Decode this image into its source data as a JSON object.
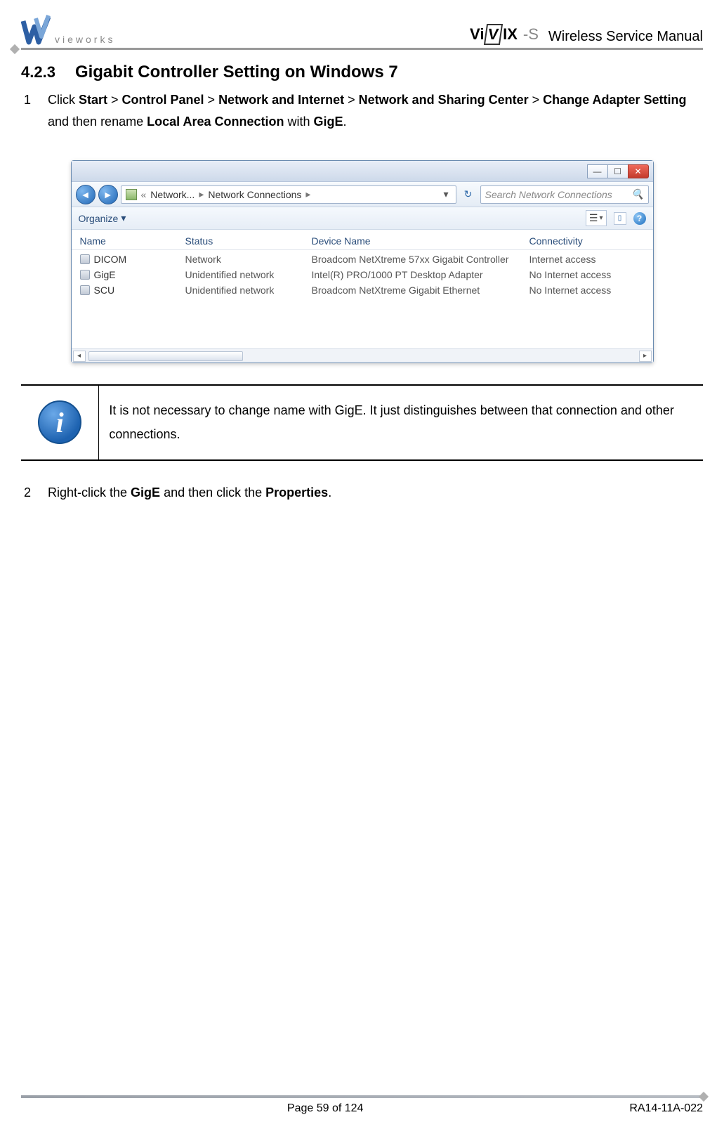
{
  "header": {
    "brand_text": "vieworks",
    "product_logo_left": "Vi",
    "product_logo_box": "V",
    "product_logo_mid": "IX",
    "product_logo_suffix": "-S",
    "doc_title": "Wireless Service Manual"
  },
  "section": {
    "number": "4.2.3",
    "title": "Gigabit Controller Setting on Windows 7"
  },
  "steps": {
    "s1_num": "1",
    "s1_parts": {
      "a": "Click ",
      "start": "Start",
      "gt1": " > ",
      "cp": "Control Panel",
      "gt2": " > ",
      "ni": "Network and Internet",
      "gt3": " > ",
      "nsc": "Network and Sharing Center",
      "gt4": " > ",
      "cas": "Change Adapter Setting",
      "mid": " and then rename ",
      "lac": "Local Area Connection",
      "with": " with ",
      "gige": "GigE",
      "end": "."
    },
    "s2_num": "2",
    "s2_parts": {
      "a": "Right-click the ",
      "gige": "GigE",
      "b": " and then click the ",
      "prop": "Properties",
      "end": "."
    }
  },
  "window": {
    "breadcrumb": {
      "chev": "«",
      "seg1": "Network...",
      "seg2": "Network Connections",
      "arrow": "▸"
    },
    "search_placeholder": "Search Network Connections",
    "organize": "Organize",
    "columns": {
      "name": "Name",
      "status": "Status",
      "device": "Device Name",
      "conn": "Connectivity"
    },
    "rows": [
      {
        "name": "DICOM",
        "status": "Network",
        "device": "Broadcom NetXtreme 57xx Gigabit Controller",
        "conn": "Internet access"
      },
      {
        "name": "GigE",
        "status": "Unidentified network",
        "device": "Intel(R) PRO/1000 PT Desktop Adapter",
        "conn": "No Internet access"
      },
      {
        "name": "SCU",
        "status": "Unidentified network",
        "device": "Broadcom NetXtreme Gigabit Ethernet",
        "conn": "No Internet access"
      }
    ]
  },
  "note_text": "It is not necessary to change name with GigE. It just distinguishes between that connection and other connections.",
  "footer": {
    "page": "Page 59 of 124",
    "code": "RA14-11A-022"
  }
}
